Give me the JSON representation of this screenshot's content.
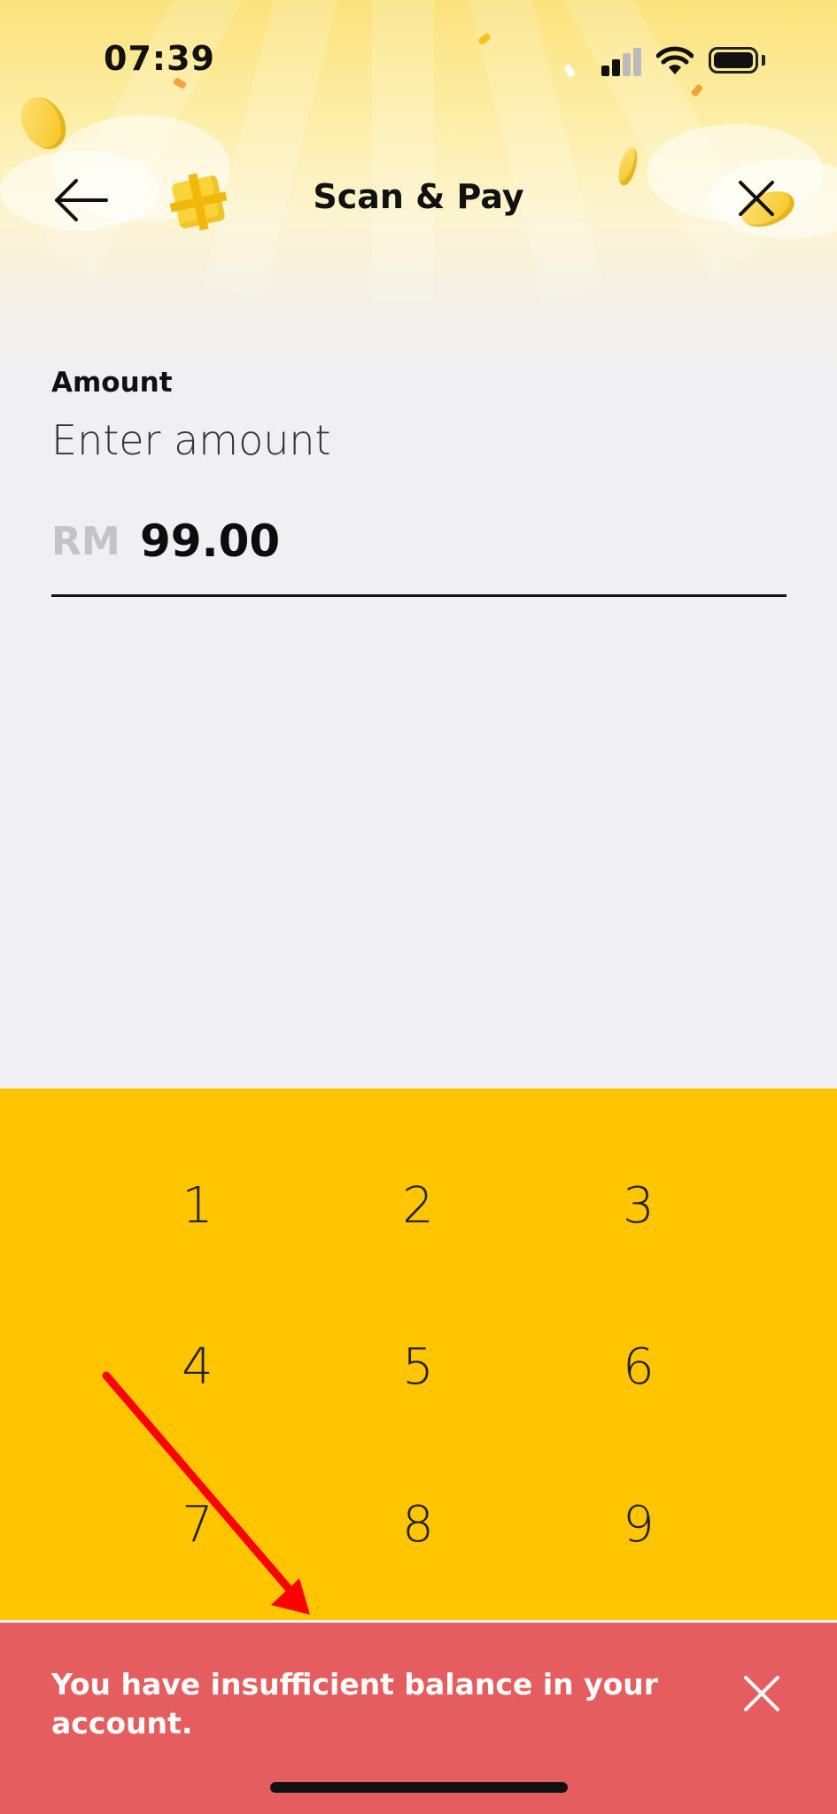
{
  "status_bar": {
    "time": "07:39"
  },
  "header": {
    "title": "Scan & Pay",
    "back_icon": "arrow-left-icon",
    "close_icon": "close-icon"
  },
  "amount": {
    "label": "Amount",
    "hint": "Enter amount",
    "currency": "RM",
    "value": "99.00"
  },
  "keypad": {
    "keys": [
      "1",
      "2",
      "3",
      "4",
      "5",
      "6",
      "7",
      "8",
      "9"
    ]
  },
  "toast": {
    "message": "You have insufficient balance in your account.",
    "close_icon": "close-icon"
  },
  "colors": {
    "keypad_bg": "#ffc500",
    "toast_bg": "#e65d5f",
    "annotation_arrow": "#ff0000"
  }
}
